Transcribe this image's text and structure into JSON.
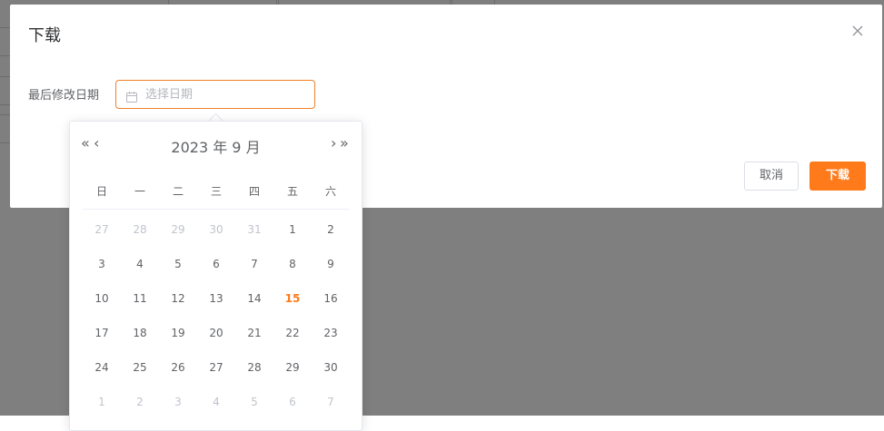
{
  "dialog": {
    "title": "下载",
    "form_label": "最后修改日期",
    "date_placeholder": "选择日期",
    "cancel_label": "取消",
    "ok_label": "下载"
  },
  "picker": {
    "header": "2023 年  9 月",
    "prev_year": "«",
    "prev_month": "‹",
    "next_month": "›",
    "next_year": "»",
    "weekdays": [
      "日",
      "一",
      "二",
      "三",
      "四",
      "五",
      "六"
    ],
    "weeks": [
      [
        {
          "d": "27",
          "o": true
        },
        {
          "d": "28",
          "o": true
        },
        {
          "d": "29",
          "o": true
        },
        {
          "d": "30",
          "o": true
        },
        {
          "d": "31",
          "o": true
        },
        {
          "d": "1"
        },
        {
          "d": "2"
        }
      ],
      [
        {
          "d": "3"
        },
        {
          "d": "4"
        },
        {
          "d": "5"
        },
        {
          "d": "6"
        },
        {
          "d": "7"
        },
        {
          "d": "8"
        },
        {
          "d": "9"
        }
      ],
      [
        {
          "d": "10"
        },
        {
          "d": "11"
        },
        {
          "d": "12"
        },
        {
          "d": "13"
        },
        {
          "d": "14"
        },
        {
          "d": "15",
          "today": true
        },
        {
          "d": "16"
        }
      ],
      [
        {
          "d": "17"
        },
        {
          "d": "18"
        },
        {
          "d": "19"
        },
        {
          "d": "20"
        },
        {
          "d": "21"
        },
        {
          "d": "22"
        },
        {
          "d": "23"
        }
      ],
      [
        {
          "d": "24"
        },
        {
          "d": "25"
        },
        {
          "d": "26"
        },
        {
          "d": "27"
        },
        {
          "d": "28"
        },
        {
          "d": "29"
        },
        {
          "d": "30"
        }
      ],
      [
        {
          "d": "1",
          "o": true
        },
        {
          "d": "2",
          "o": true
        },
        {
          "d": "3",
          "o": true
        },
        {
          "d": "4",
          "o": true
        },
        {
          "d": "5",
          "o": true
        },
        {
          "d": "6",
          "o": true
        },
        {
          "d": "7",
          "o": true
        }
      ]
    ]
  },
  "colors": {
    "accent": "#ff7a1a",
    "mask": "rgba(0,0,0,0.5)"
  },
  "icons": {
    "close": "close-icon",
    "calendar": "calendar-icon"
  }
}
